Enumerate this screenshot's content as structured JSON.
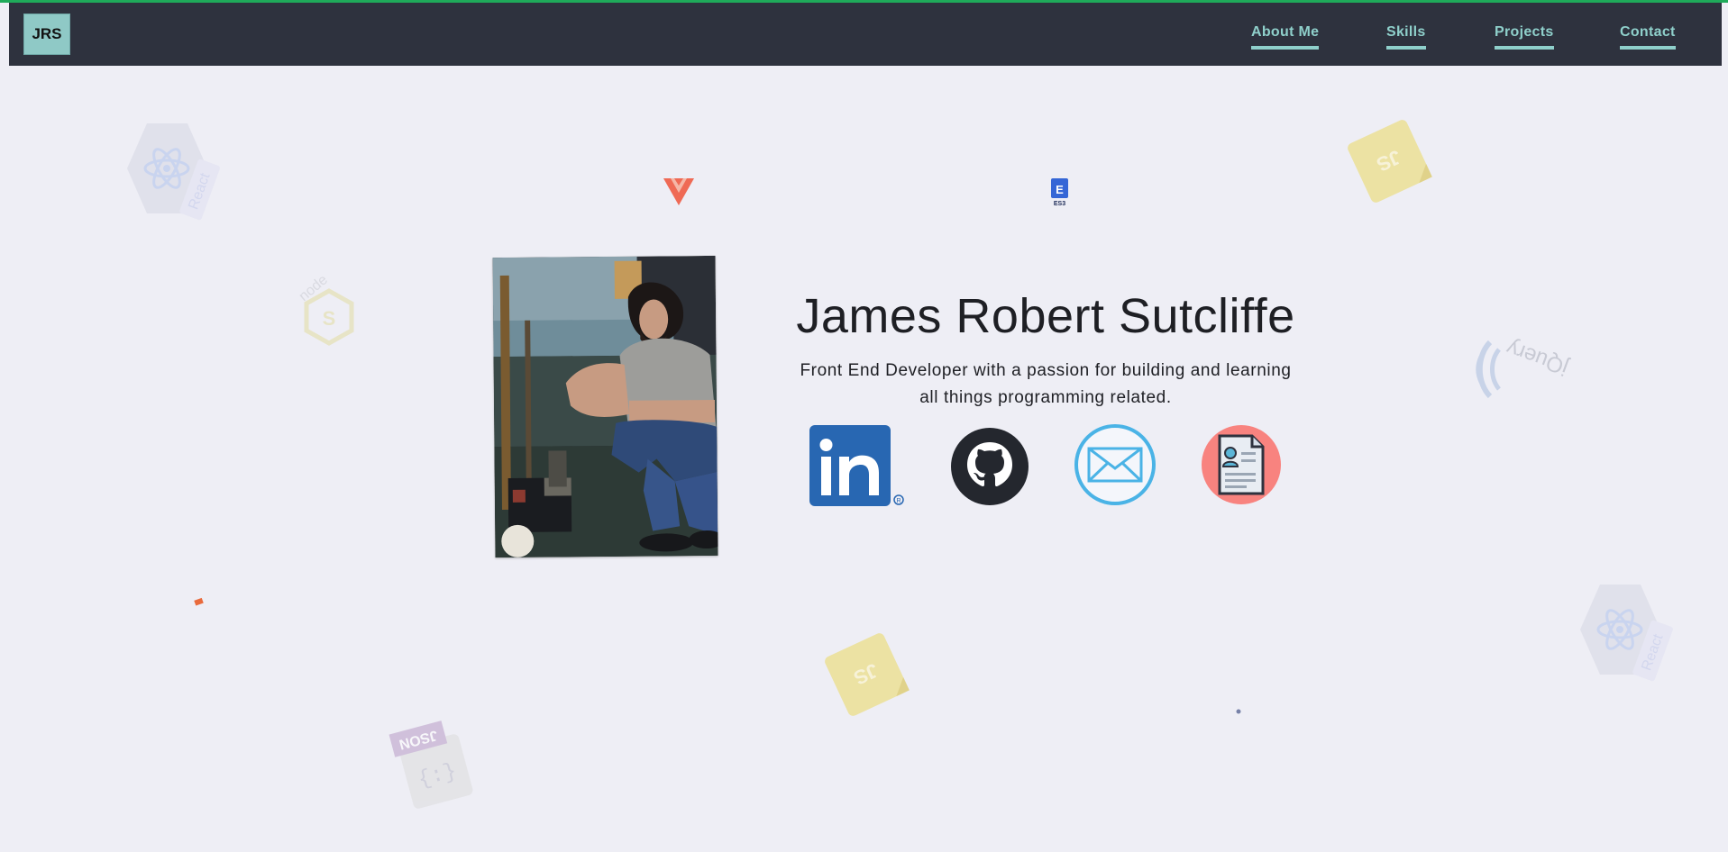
{
  "nav": {
    "logo": "JRS",
    "items": [
      {
        "label": "About Me"
      },
      {
        "label": "Skills"
      },
      {
        "label": "Projects"
      },
      {
        "label": "Contact"
      }
    ]
  },
  "hero": {
    "name": "James Robert Sutcliffe",
    "tagline_line1": "Front End Developer with a passion for building and learning",
    "tagline_line2": "all things programming related."
  },
  "social": [
    {
      "icon": "linkedin-icon"
    },
    {
      "icon": "github-icon"
    },
    {
      "icon": "email-icon"
    },
    {
      "icon": "resume-icon"
    }
  ],
  "background_icons": [
    "react-icon",
    "vue-icon",
    "es6-icon",
    "js-icon",
    "node-icon",
    "jquery-icon",
    "json-icon",
    "html-icon"
  ],
  "decor_text": {
    "react": "React",
    "js": "JS",
    "json": "JSON",
    "jquery": "jQuery",
    "node": "node",
    "es6": "ES3"
  },
  "colors": {
    "navbar": "#2e323e",
    "accent": "#8fd0cb",
    "background": "#eeeef5",
    "topline": "#1faa5a"
  }
}
